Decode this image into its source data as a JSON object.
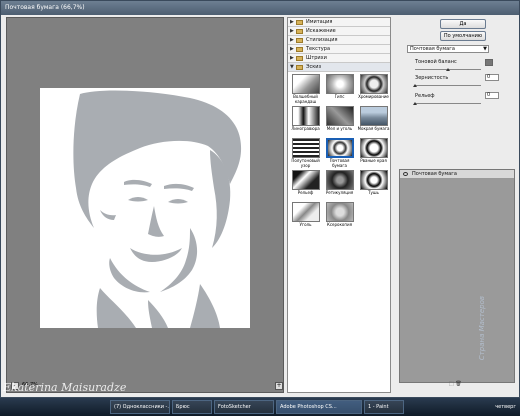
{
  "window": {
    "title": "Почтовая бумага (66,7%)"
  },
  "preview": {
    "zoom_minus": "–",
    "zoom_plus": "+",
    "zoom": "66,7%"
  },
  "filter_gallery": {
    "categories": [
      {
        "label": "Имитация",
        "open": false
      },
      {
        "label": "Искажение",
        "open": false
      },
      {
        "label": "Стилизация",
        "open": false
      },
      {
        "label": "Текстура",
        "open": false
      },
      {
        "label": "Штрихи",
        "open": false
      },
      {
        "label": "Эскиз",
        "open": true
      }
    ],
    "thumbnails": [
      {
        "label": "Волшебный карандаш",
        "selected": false
      },
      {
        "label": "Гипс",
        "selected": false
      },
      {
        "label": "Хромирование",
        "selected": false
      },
      {
        "label": "Линогравюра",
        "selected": false
      },
      {
        "label": "Мел и уголь",
        "selected": false
      },
      {
        "label": "Мокрая бумага",
        "selected": false
      },
      {
        "label": "Полутоновый узор",
        "selected": false
      },
      {
        "label": "Почтовая бумага",
        "selected": true
      },
      {
        "label": "Рваные края",
        "selected": false
      },
      {
        "label": "Рельеф",
        "selected": false
      },
      {
        "label": "Ретикуляция",
        "selected": false
      },
      {
        "label": "Тушь",
        "selected": false
      },
      {
        "label": "Уголь",
        "selected": false
      },
      {
        "label": "Ксерокопия",
        "selected": false
      }
    ]
  },
  "controls": {
    "ok_label": "Да",
    "default_label": "По умолчанию",
    "filter_select": "Почтовая бумага",
    "params": [
      {
        "label": "Тоновой баланс",
        "value": "",
        "level": 0.5
      },
      {
        "label": "Зернистость",
        "value": "0",
        "level": 0.0
      },
      {
        "label": "Рельеф",
        "value": "0",
        "level": 0.0
      }
    ],
    "layer_name": "Почтовая бумага",
    "panel_icons": "⬚ 🗑"
  },
  "taskbar": {
    "tasks": [
      {
        "label": "(7) Одноклассники -...",
        "active": false
      },
      {
        "label": "Брюс",
        "active": false
      },
      {
        "label": "FotoSketcher",
        "active": false
      },
      {
        "label": "Adobe Photoshop CS...",
        "active": true
      },
      {
        "label": "1 - Paint",
        "active": false
      }
    ],
    "clock": "четверг"
  },
  "watermarks": {
    "author": "Ekaterina Maisuradze",
    "site": "Страна Мастеров"
  },
  "colors": {
    "silhouette": "#a9adb2",
    "selection": "#1a5fb4"
  }
}
